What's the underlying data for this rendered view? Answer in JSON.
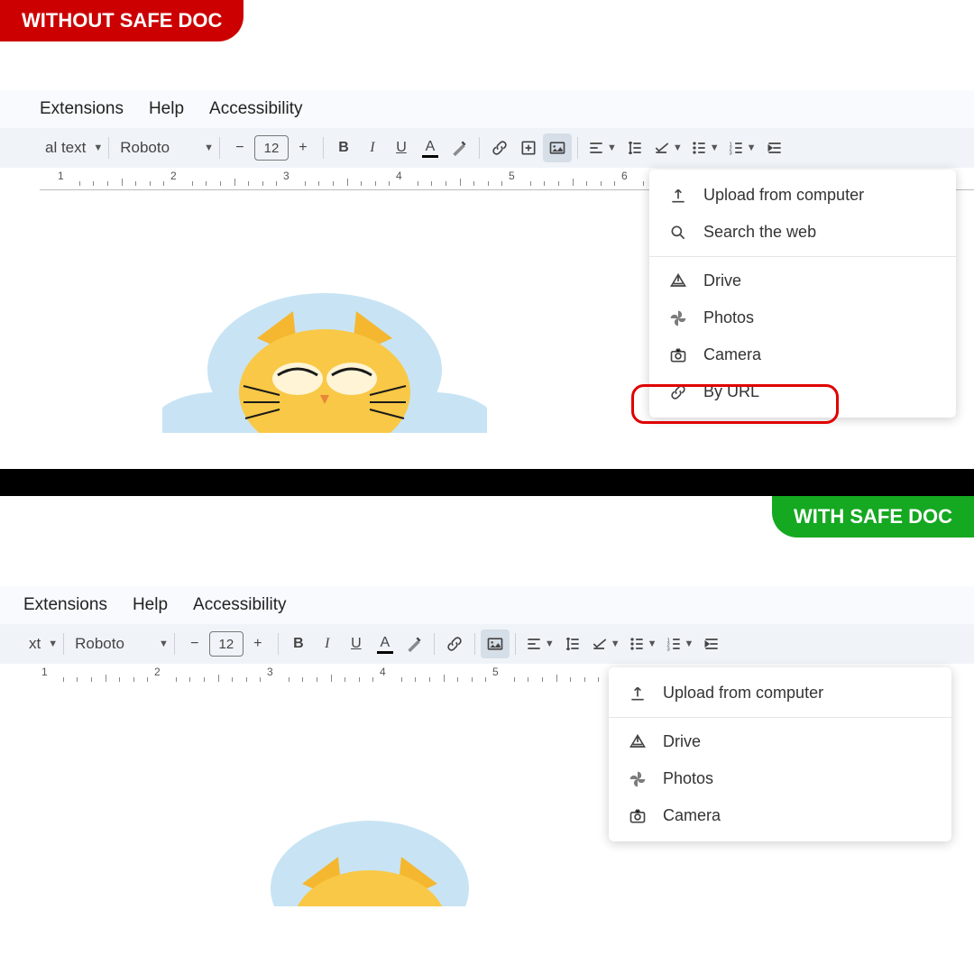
{
  "badges": {
    "without": "WITHOUT SAFE DOC",
    "with": "WITH SAFE DOC"
  },
  "menubar": {
    "extensions": "Extensions",
    "help": "Help",
    "accessibility": "Accessibility"
  },
  "toolbar": {
    "style1": "al text",
    "style2": "xt",
    "font": "Roboto",
    "fontsize": "12",
    "bold": "B",
    "italic": "I",
    "underline": "U",
    "color": "A"
  },
  "ruler": [
    "1",
    "2",
    "3",
    "4",
    "5",
    "6"
  ],
  "menu1": {
    "upload": "Upload from computer",
    "search": "Search the web",
    "drive": "Drive",
    "photos": "Photos",
    "camera": "Camera",
    "byurl": "By URL"
  },
  "menu2": {
    "upload": "Upload from computer",
    "drive": "Drive",
    "photos": "Photos",
    "camera": "Camera"
  }
}
